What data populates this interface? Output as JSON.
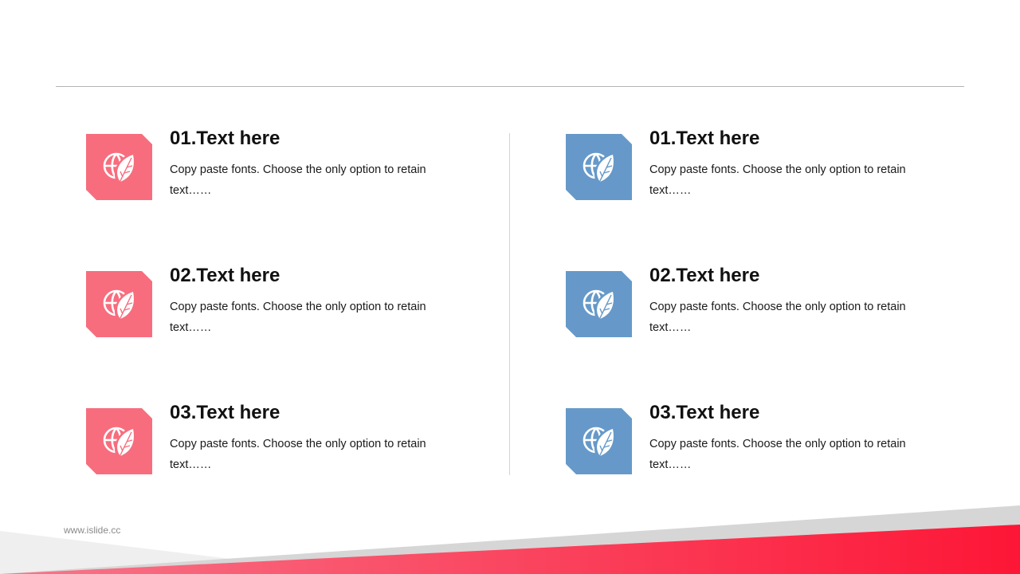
{
  "slide": {
    "footer_url": "www.islide.cc",
    "left_column": {
      "accent_color": "#f76d7e",
      "items": [
        {
          "title": "01.Text here",
          "body": "Copy paste fonts. Choose the only option to retain text……",
          "icon": "globe-leaf-icon"
        },
        {
          "title": "02.Text here",
          "body": "Copy paste fonts. Choose the only option to retain text……",
          "icon": "globe-leaf-icon"
        },
        {
          "title": "03.Text here",
          "body": "Copy paste fonts. Choose the only option to retain text……",
          "icon": "globe-leaf-icon"
        }
      ]
    },
    "right_column": {
      "accent_color": "#6699c9",
      "items": [
        {
          "title": "01.Text here",
          "body": "Copy paste fonts. Choose the only option to retain text……",
          "icon": "globe-leaf-icon"
        },
        {
          "title": "02.Text here",
          "body": "Copy paste fonts. Choose the only option to retain text……",
          "icon": "globe-leaf-icon"
        },
        {
          "title": "03.Text here",
          "body": "Copy paste fonts. Choose the only option to retain text……",
          "icon": "globe-leaf-icon"
        }
      ]
    },
    "bottom_gradient": {
      "from": "#f7768a",
      "to": "#fd1636"
    }
  }
}
